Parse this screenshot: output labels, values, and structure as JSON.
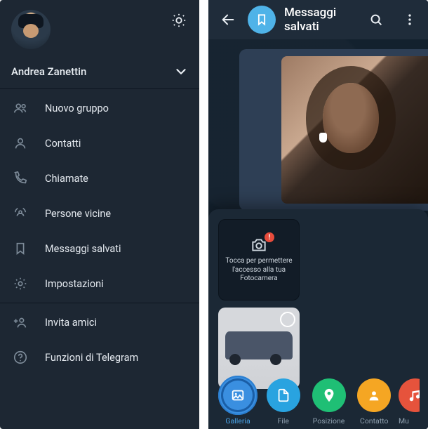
{
  "left": {
    "user_name": "Andrea Zanettin",
    "menu": [
      {
        "icon": "group",
        "label": "Nuovo gruppo"
      },
      {
        "icon": "person",
        "label": "Contatti"
      },
      {
        "icon": "phone",
        "label": "Chiamate"
      },
      {
        "icon": "nearby",
        "label": "Persone vicine"
      },
      {
        "icon": "bookmark",
        "label": "Messaggi salvati"
      },
      {
        "icon": "gear",
        "label": "Impostazioni"
      }
    ],
    "menu2": [
      {
        "icon": "invite",
        "label": "Invita amici"
      },
      {
        "icon": "help",
        "label": "Funzioni di Telegram"
      }
    ]
  },
  "right": {
    "title": "Messaggi salvati",
    "camera_prompt": "Tocca per permettere l'accesso alla tua Fotocamera",
    "attach": {
      "gallery": "Galleria",
      "file": "File",
      "location": "Posizione",
      "contact": "Contatto",
      "music": "Mu"
    }
  }
}
